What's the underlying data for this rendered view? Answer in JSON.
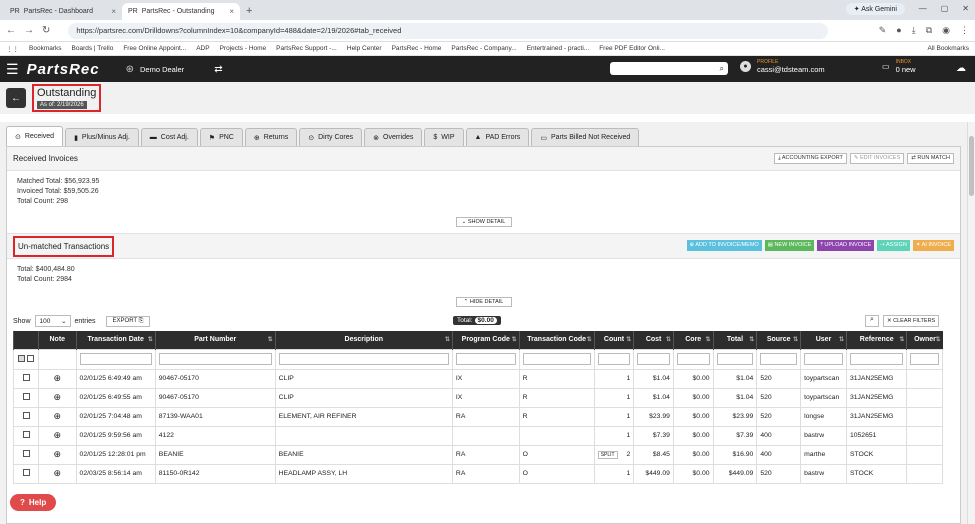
{
  "browser": {
    "tabs": [
      {
        "title": "PartsRec - Dashboard",
        "active": false
      },
      {
        "title": "PartsRec - Outstanding",
        "active": true
      }
    ],
    "new_tab": "+",
    "gemini": "Ask Gemini",
    "url": "https://partsrec.com/Drilldowns?columnIndex=10&companyId=488&date=2/19/2026#tab_received",
    "bookmarks": [
      "Bookmarks",
      "Boards | Trello",
      "Free Online Appoint...",
      "ADP",
      "Projects - Home",
      "PartsRec Support -...",
      "Help Center",
      "PartsRec - Home",
      "PartsRec - Company...",
      "Entertrained - practi...",
      "Free PDF Editor Onli..."
    ],
    "all_bookmarks": "All Bookmarks"
  },
  "header": {
    "logo": "PartsRec",
    "dealer": "Demo Dealer",
    "profile_label": "PROFILE",
    "profile_email": "cassi@tdsteam.com",
    "inbox_label": "INBOX",
    "inbox_value": "0 new"
  },
  "page": {
    "title": "Outstanding",
    "as_of": "As of: 2/19/2026"
  },
  "tabs": [
    {
      "icon": "⊙",
      "label": "Received",
      "active": true
    },
    {
      "icon": "▮",
      "label": "Plus/Minus Adj."
    },
    {
      "icon": "▬",
      "label": "Cost Adj."
    },
    {
      "icon": "⚑",
      "label": "PNC"
    },
    {
      "icon": "⊕",
      "label": "Returns"
    },
    {
      "icon": "⊙",
      "label": "Dirty Cores"
    },
    {
      "icon": "⊗",
      "label": "Overrides"
    },
    {
      "icon": "$",
      "label": "WIP"
    },
    {
      "icon": "▲",
      "label": "PAD Errors"
    },
    {
      "icon": "▭",
      "label": "Parts Billed Not Received"
    }
  ],
  "received": {
    "title": "Received Invoices",
    "buttons": {
      "export": "ACCOUNTING EXPORT",
      "edit": "EDIT INVOICES",
      "run": "RUN MATCH"
    },
    "lines": [
      "Matched Total: $56,923.95",
      "Invoiced Total: $59,505.26",
      "Total Count: 298"
    ],
    "detail": "SHOW DETAIL"
  },
  "unmatched": {
    "title": "Un-matched Transactions",
    "buttons": [
      {
        "label": "ADD TO INVOICE/MEMO",
        "color": "#5bc0de"
      },
      {
        "label": "NEW INVOICE",
        "color": "#5cb85c"
      },
      {
        "label": "UPLOAD INVOICE",
        "color": "#8e44ad"
      },
      {
        "label": "ASSIGN",
        "color": "#5fd3b8"
      },
      {
        "label": "AI INVOICE",
        "color": "#f0ad4e"
      }
    ],
    "lines": [
      "Total: $400,484.80",
      "Total Count: 2984"
    ],
    "detail": "HIDE DETAIL"
  },
  "table_controls": {
    "show": "Show",
    "entries": "entries",
    "length": "100",
    "export": "EXPORT",
    "total_label": "Total:",
    "total_value": "$0.00",
    "clear": "CLEAR FILTERS"
  },
  "columns": [
    "",
    "Note",
    "Transaction Date",
    "Part Number",
    "Description",
    "Program Code",
    "Transaction Code",
    "Count",
    "Cost",
    "Core",
    "Total",
    "Source",
    "User",
    "Reference",
    "Owner"
  ],
  "rows": [
    [
      "02/01/25 6:49:49 am",
      "90467-05170",
      "CLIP",
      "IX",
      "R",
      "1",
      "$1.04",
      "$0.00",
      "$1.04",
      "520",
      "toypartscan",
      "31JAN25EMG",
      ""
    ],
    [
      "02/01/25 6:49:55 am",
      "90467-05170",
      "CLIP",
      "IX",
      "R",
      "1",
      "$1.04",
      "$0.00",
      "$1.04",
      "520",
      "toypartscan",
      "31JAN25EMG",
      ""
    ],
    [
      "02/01/25 7:04:48 am",
      "87139-WAA01",
      "ELEMENT, AIR REFINER",
      "RA",
      "R",
      "1",
      "$23.99",
      "$0.00",
      "$23.99",
      "520",
      "longse",
      "31JAN25EMG",
      ""
    ],
    [
      "02/01/25 9:59:56 am",
      "4122",
      "",
      "",
      "",
      "1",
      "$7.39",
      "$0.00",
      "$7.39",
      "400",
      "bastrw",
      "1052651",
      ""
    ],
    [
      "02/01/25 12:28:01 pm",
      "BEANIE",
      "BEANIE",
      "RA",
      "O",
      "2",
      "$8.45",
      "$0.00",
      "$16.90",
      "400",
      "marthe",
      "STOCK",
      ""
    ],
    [
      "02/03/25 8:56:14 am",
      "81150-0R142",
      "HEADLAMP ASSY, LH",
      "RA",
      "O",
      "1",
      "$449.09",
      "$0.00",
      "$449.09",
      "520",
      "bastrw",
      "STOCK",
      ""
    ]
  ],
  "split_label": "SPLIT",
  "help": "Help"
}
